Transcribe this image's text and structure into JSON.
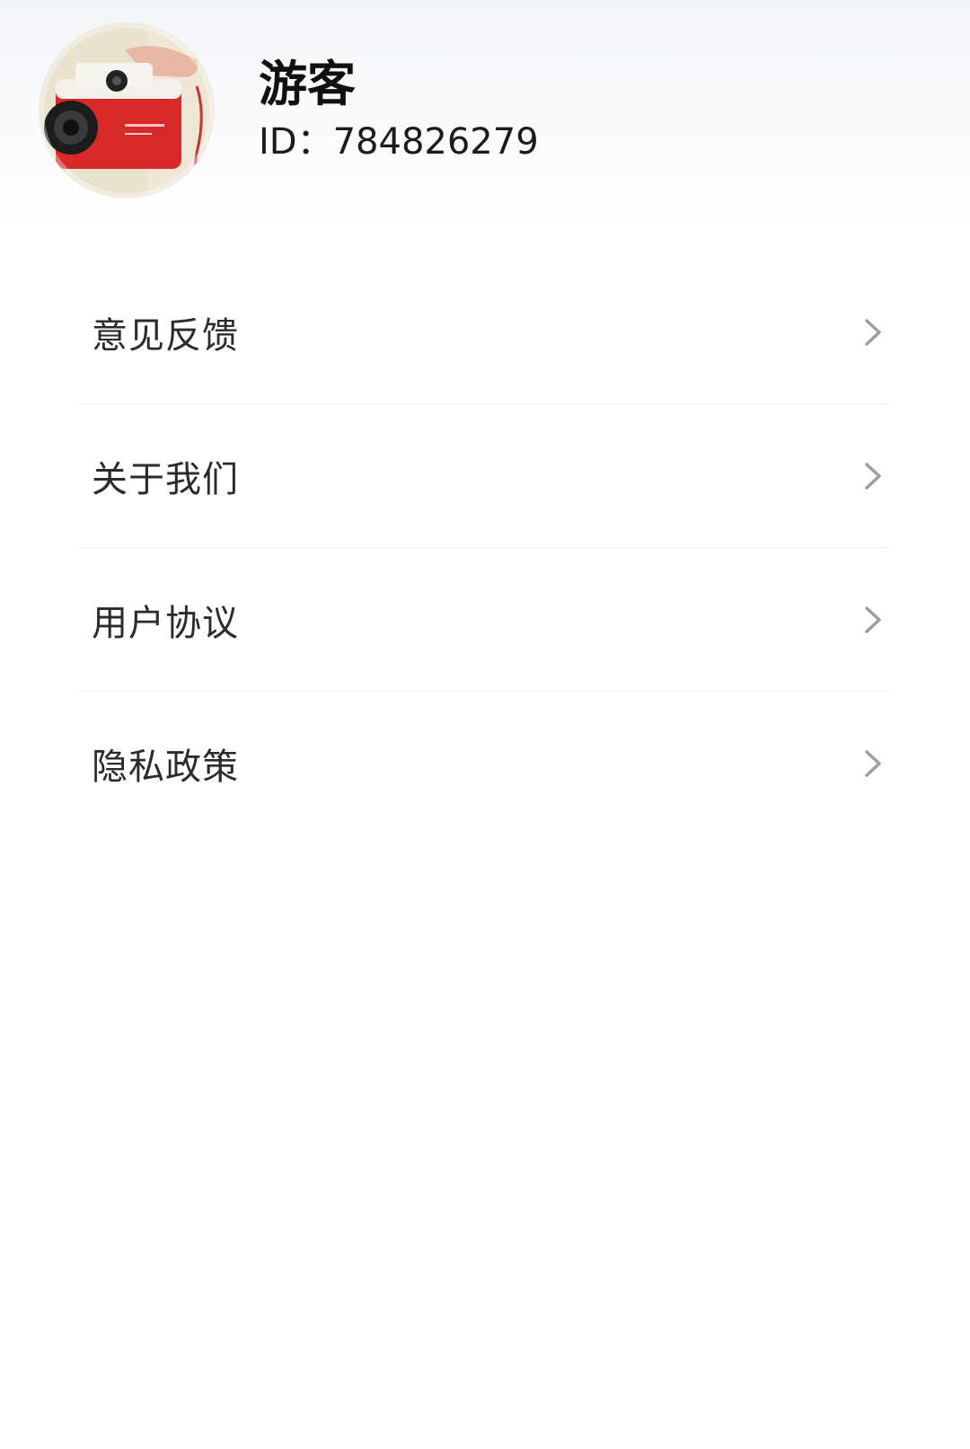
{
  "profile": {
    "name": "游客",
    "id_label": "ID：784826279",
    "avatar_icon": "camera-photo-avatar"
  },
  "menu": {
    "items": [
      {
        "label": "意见反馈",
        "icon": "chevron-right-icon"
      },
      {
        "label": "关于我们",
        "icon": "chevron-right-icon"
      },
      {
        "label": "用户协议",
        "icon": "chevron-right-icon"
      },
      {
        "label": "隐私政策",
        "icon": "chevron-right-icon"
      }
    ]
  },
  "colors": {
    "text_primary": "#111111",
    "text_menu": "#2b2b2b",
    "chevron": "#9e9e9e",
    "divider": "#eeeeee",
    "camera_red": "#d92a2a"
  }
}
